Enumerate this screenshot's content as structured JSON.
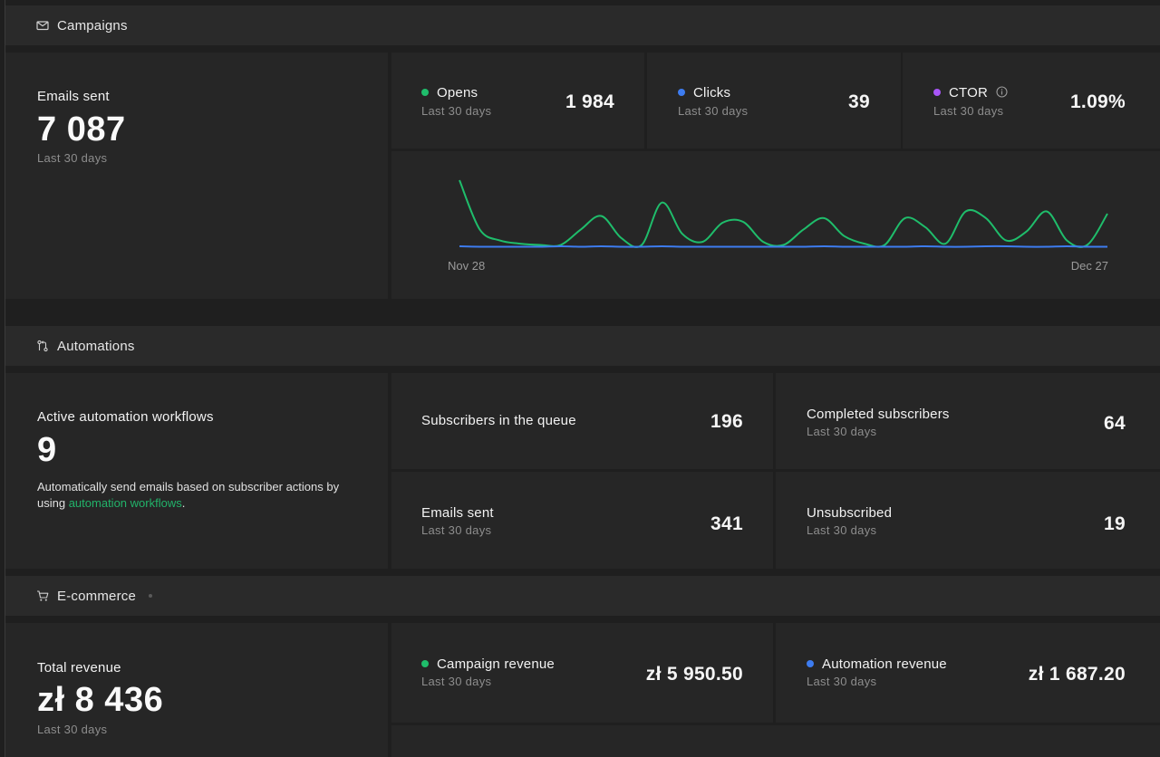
{
  "campaigns": {
    "header": "Campaigns",
    "icon": "mail-icon",
    "emails_sent": {
      "label": "Emails sent",
      "value": "7 087",
      "period": "Last 30 days"
    },
    "metrics": [
      {
        "label": "Opens",
        "period": "Last 30 days",
        "value": "1 984",
        "color": "#1fbd6b"
      },
      {
        "label": "Clicks",
        "period": "Last 30 days",
        "value": "39",
        "color": "#3d7cf0"
      },
      {
        "label": "CTOR",
        "period": "Last 30 days",
        "value": "1.09%",
        "color": "#a855f7",
        "info_icon": "info-icon"
      }
    ],
    "chart_data": {
      "type": "line",
      "x_start": "Nov 28",
      "x_end": "Dec 27",
      "x_tick_labels": [
        "Nov 28",
        "Dec 27"
      ],
      "grid": false,
      "series": [
        {
          "color": "#1fbd6b",
          "values": [
            150,
            40,
            15,
            8,
            5,
            5,
            40,
            70,
            20,
            5,
            100,
            30,
            12,
            55,
            57,
            12,
            5,
            40,
            65,
            25,
            8,
            5,
            65,
            45,
            8,
            80,
            65,
            15,
            35,
            80,
            15,
            5,
            75
          ]
        },
        {
          "color": "#3d7cf0",
          "values": [
            2,
            1,
            1,
            1,
            1,
            2,
            1,
            2,
            1,
            1,
            2,
            1,
            1,
            1,
            1,
            1,
            1,
            1,
            2,
            1,
            1,
            1,
            1,
            2,
            1,
            1,
            2,
            2,
            1,
            1,
            2,
            1,
            1
          ]
        }
      ]
    }
  },
  "automations": {
    "header": "Automations",
    "icon": "workflow-icon",
    "active": {
      "label": "Active automation workflows",
      "value": "9",
      "desc_before": "Automatically send emails based on subscriber actions by using ",
      "desc_link": "automation workflows",
      "desc_after": "."
    },
    "queue": {
      "label": "Subscribers in the queue",
      "value": "196"
    },
    "completed": {
      "label": "Completed subscribers",
      "period": "Last 30 days",
      "value": "64"
    },
    "emails_sent": {
      "label": "Emails sent",
      "period": "Last 30 days",
      "value": "341"
    },
    "unsubscribed": {
      "label": "Unsubscribed",
      "period": "Last 30 days",
      "value": "19"
    }
  },
  "ecommerce": {
    "header": "E-commerce",
    "icon": "cart-icon",
    "total": {
      "label": "Total revenue",
      "value": "zł 8 436",
      "period": "Last 30 days"
    },
    "campaign_revenue": {
      "label": "Campaign revenue",
      "period": "Last 30 days",
      "value": "zł 5 950.50",
      "color": "#1fbd6b"
    },
    "automation_revenue": {
      "label": "Automation revenue",
      "period": "Last 30 days",
      "value": "zł 1 687.20",
      "color": "#3d7cf0"
    }
  }
}
